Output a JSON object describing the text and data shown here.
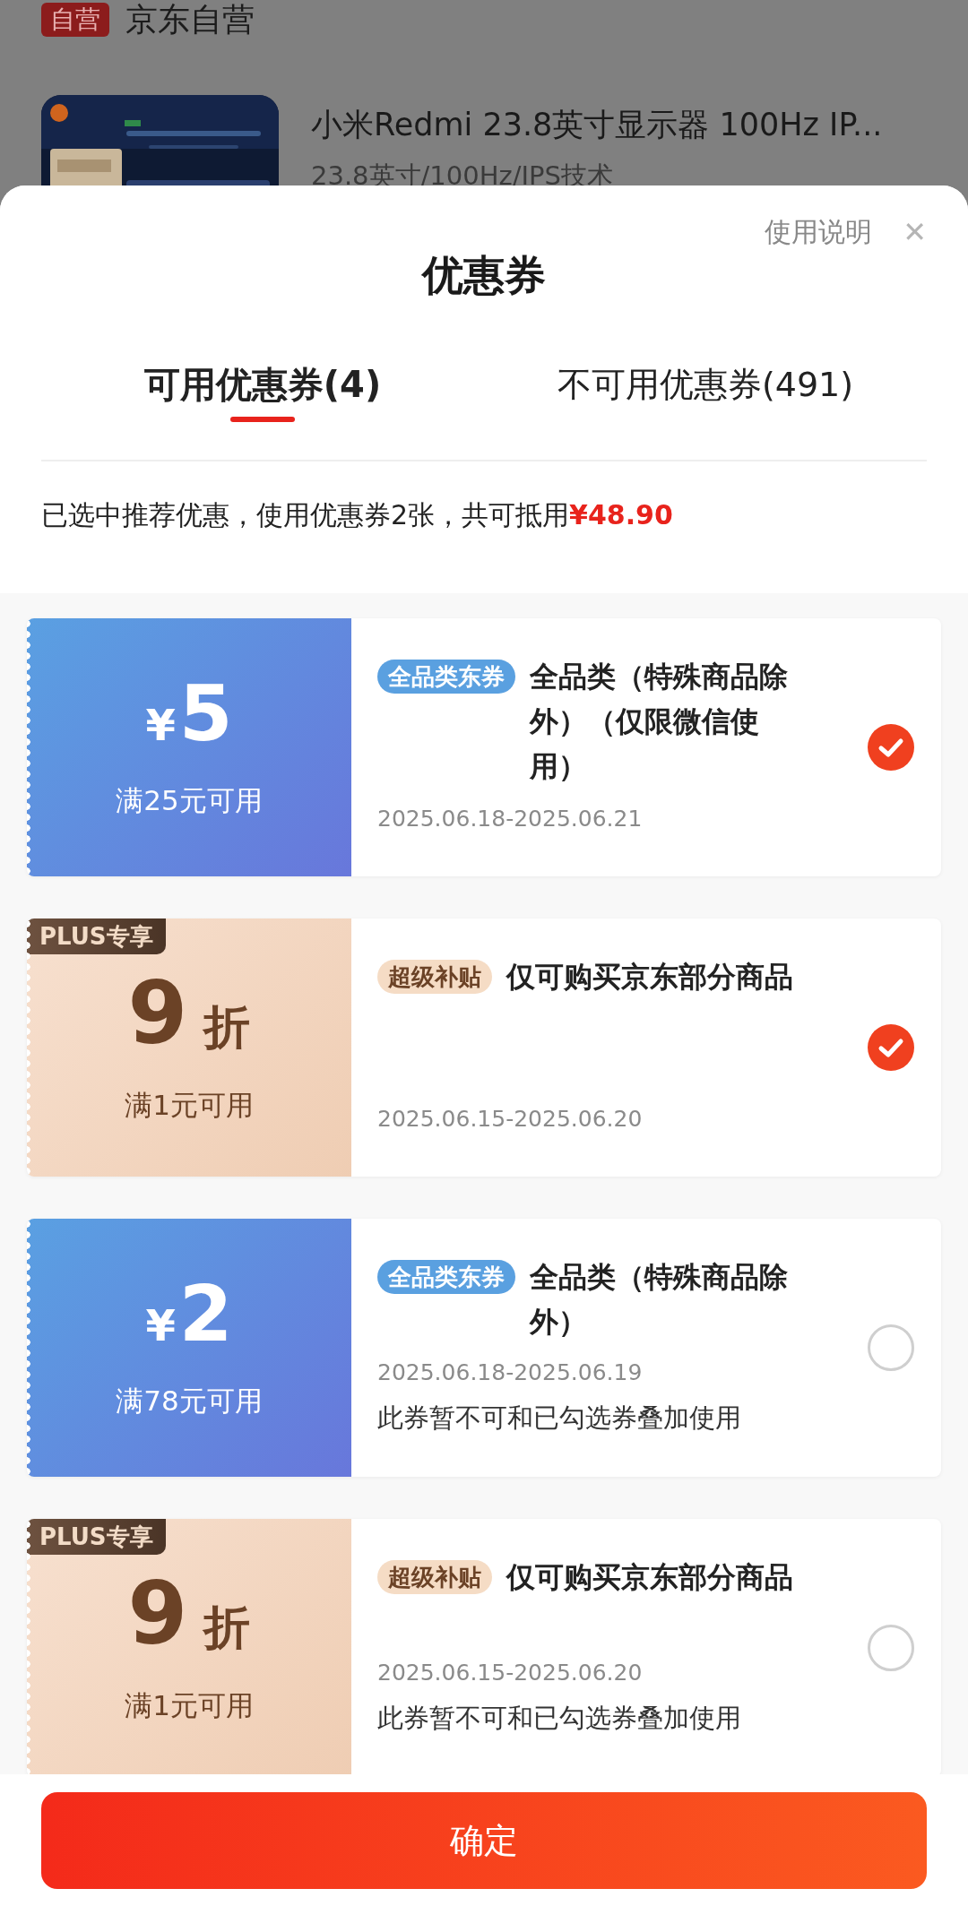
{
  "background_page": {
    "store_badge": "自营",
    "store_name": "京东自营",
    "product": {
      "title": "小米Redmi 23.8英寸显示器 100Hz IP...",
      "spec": "23.8英寸/100Hz/IPS技术"
    }
  },
  "sheet": {
    "help_link": "使用说明",
    "close": "✕",
    "title": "优惠券"
  },
  "tabs": [
    {
      "label": "可用优惠券(4)",
      "selected": true
    },
    {
      "label": "不可用优惠券(491)",
      "selected": false
    }
  ],
  "summary": {
    "text": "已选中推荐优惠，使用优惠券2张，共可抵用",
    "amount": "¥48.90"
  },
  "coupons": [
    {
      "kind": "cash",
      "currency": "¥",
      "value": "5",
      "condition": "满25元可用",
      "tag": {
        "kind": "jd",
        "text": "全品类东券"
      },
      "title": "全品类（特殊商品除外）（仅限微信使用）",
      "date": "2025.06.18-2025.06.21",
      "selected": true
    },
    {
      "kind": "discount",
      "badge": "PLUS专享",
      "value": "9",
      "unit": "折",
      "condition": "满1元可用",
      "tag": {
        "kind": "subsidy",
        "text": "超级补贴"
      },
      "title": "仅可购买京东部分商品",
      "date": "2025.06.15-2025.06.20",
      "selected": true
    },
    {
      "kind": "cash",
      "currency": "¥",
      "value": "2",
      "condition": "满78元可用",
      "tag": {
        "kind": "jd",
        "text": "全品类东券"
      },
      "title": "全品类（特殊商品除外）",
      "date": "2025.06.18-2025.06.19",
      "note": "此券暂不可和已勾选券叠加使用",
      "selected": false
    },
    {
      "kind": "discount",
      "badge": "PLUS专享",
      "value": "9",
      "unit": "折",
      "condition": "满1元可用",
      "tag": {
        "kind": "subsidy",
        "text": "超级补贴"
      },
      "title": "仅可购买京东部分商品",
      "date": "2025.06.15-2025.06.20",
      "note": "此券暂不可和已勾选券叠加使用",
      "selected": false
    }
  ],
  "confirm_button": "确定"
}
